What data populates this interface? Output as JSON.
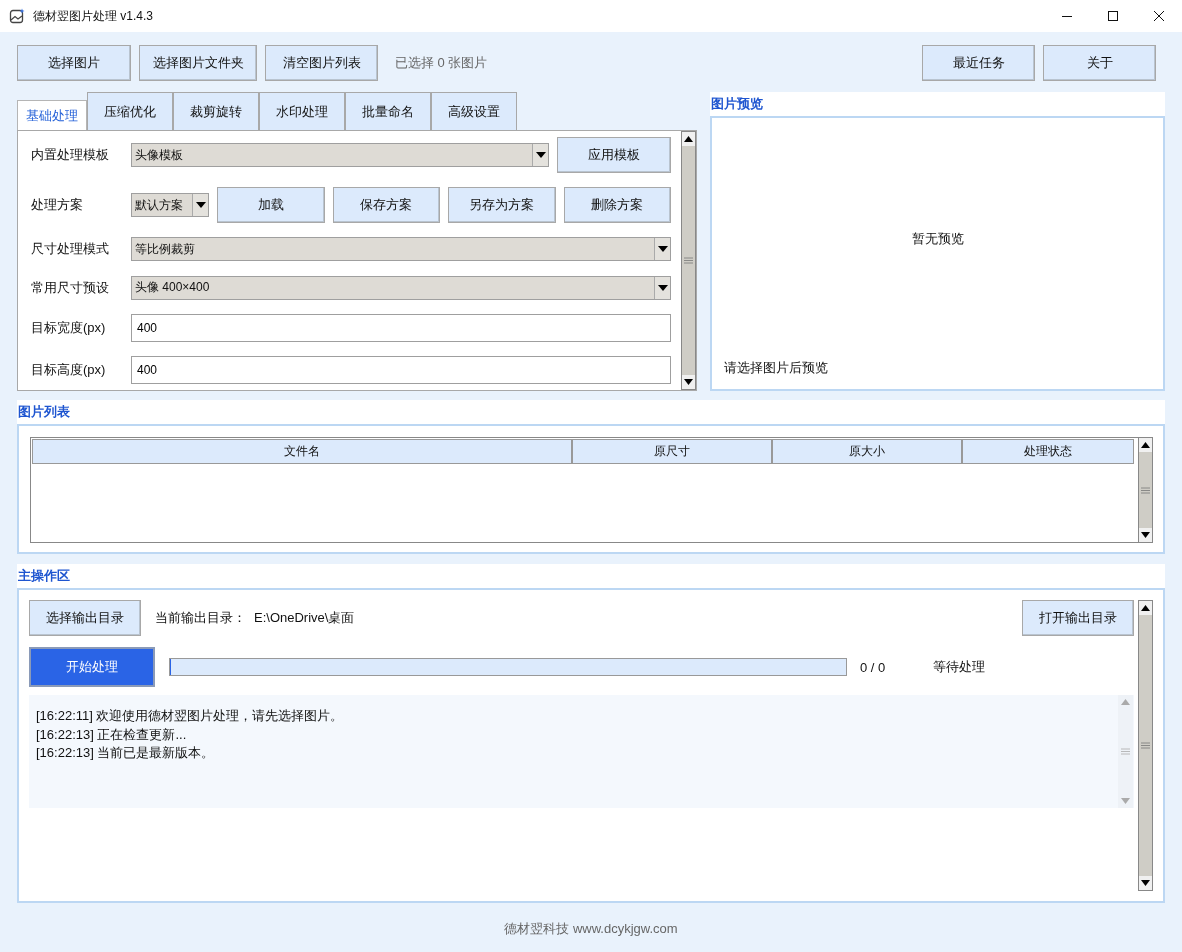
{
  "window": {
    "title": "德材翌图片处理 v1.4.3"
  },
  "toolbar": {
    "left_buttons": [
      "选择图片",
      "选择图片文件夹",
      "清空图片列表"
    ],
    "selection_count": "已选择 0 张图片",
    "right_buttons": [
      "最近任务",
      "关于"
    ]
  },
  "tabs": [
    {
      "label": "基础处理",
      "selected": true
    },
    {
      "label": "压缩优化",
      "selected": false
    },
    {
      "label": "裁剪旋转",
      "selected": false
    },
    {
      "label": "水印处理",
      "selected": false
    },
    {
      "label": "批量命名",
      "selected": false
    },
    {
      "label": "高级设置",
      "selected": false
    }
  ],
  "basic_settings": [
    {
      "kind": "dropdown",
      "label": "内置处理模板",
      "value": "头像模板",
      "buttons": [
        "应用模板"
      ]
    },
    {
      "kind": "scheme",
      "label": "处理方案",
      "value": "默认方案",
      "buttons": [
        "加载",
        "保存方案",
        "另存为方案",
        "删除方案"
      ]
    },
    {
      "kind": "dropdown",
      "label": "尺寸处理模式",
      "value": "等比例裁剪"
    },
    {
      "kind": "dropdown",
      "label": "常用尺寸预设",
      "value": "头像 400×400"
    },
    {
      "kind": "input",
      "label": "目标宽度(px)",
      "value": "400"
    },
    {
      "kind": "input",
      "label": "目标高度(px)",
      "value": "400"
    }
  ],
  "preview": {
    "title": "图片预览",
    "empty_text": "暂无预览",
    "hint": "请选择图片后预览"
  },
  "image_list": {
    "title": "图片列表",
    "columns": [
      "文件名",
      "原尺寸",
      "原大小",
      "处理状态"
    ]
  },
  "main_area": {
    "title": "主操作区",
    "choose_output_button": "选择输出目录",
    "output_dir_label": "当前输出目录：",
    "output_dir": "E:\\OneDrive\\桌面",
    "open_output_button": "打开输出目录",
    "start_button": "开始处理",
    "progress": {
      "level": 0,
      "reading": "0 / 0"
    },
    "status": "等待处理",
    "log": [
      "[16:22:11] 欢迎使用德材翌图片处理，请先选择图片。",
      "[16:22:13] 正在检查更新...",
      "[16:22:13] 当前已是最新版本。"
    ]
  },
  "footer": "德材翌科技 www.dcykjgw.com"
}
